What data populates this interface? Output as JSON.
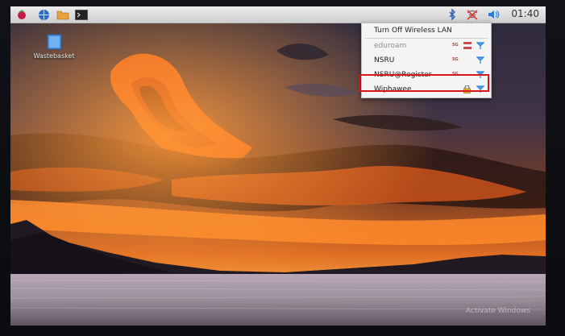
{
  "taskbar": {
    "clock": "01:40",
    "icons": [
      "raspberry-menu-icon",
      "web-browser-icon",
      "file-manager-icon",
      "terminal-icon",
      "bluetooth-icon",
      "wifi-disabled-icon",
      "volume-icon"
    ]
  },
  "desktop": {
    "wastebasket_label": "Wastebasket"
  },
  "wifi_menu": {
    "toggle_label": "Turn Off Wireless LAN",
    "networks": [
      {
        "name": "eduroam",
        "badge": "5G",
        "secured": false
      },
      {
        "name": "NSRU",
        "badge": "5G",
        "secured": false
      },
      {
        "name": "NSRU@Register",
        "badge": "5G",
        "secured": false
      },
      {
        "name": "Wiphawee",
        "badge": "",
        "secured": true
      }
    ]
  },
  "overlay": {
    "watermark_text": "Activate Windows",
    "highlight_color": "#d8151b"
  },
  "colors": {
    "sky_top": "#3d3650",
    "sunset_orange": "#ff7a1f",
    "water": "#c9b9c5"
  }
}
